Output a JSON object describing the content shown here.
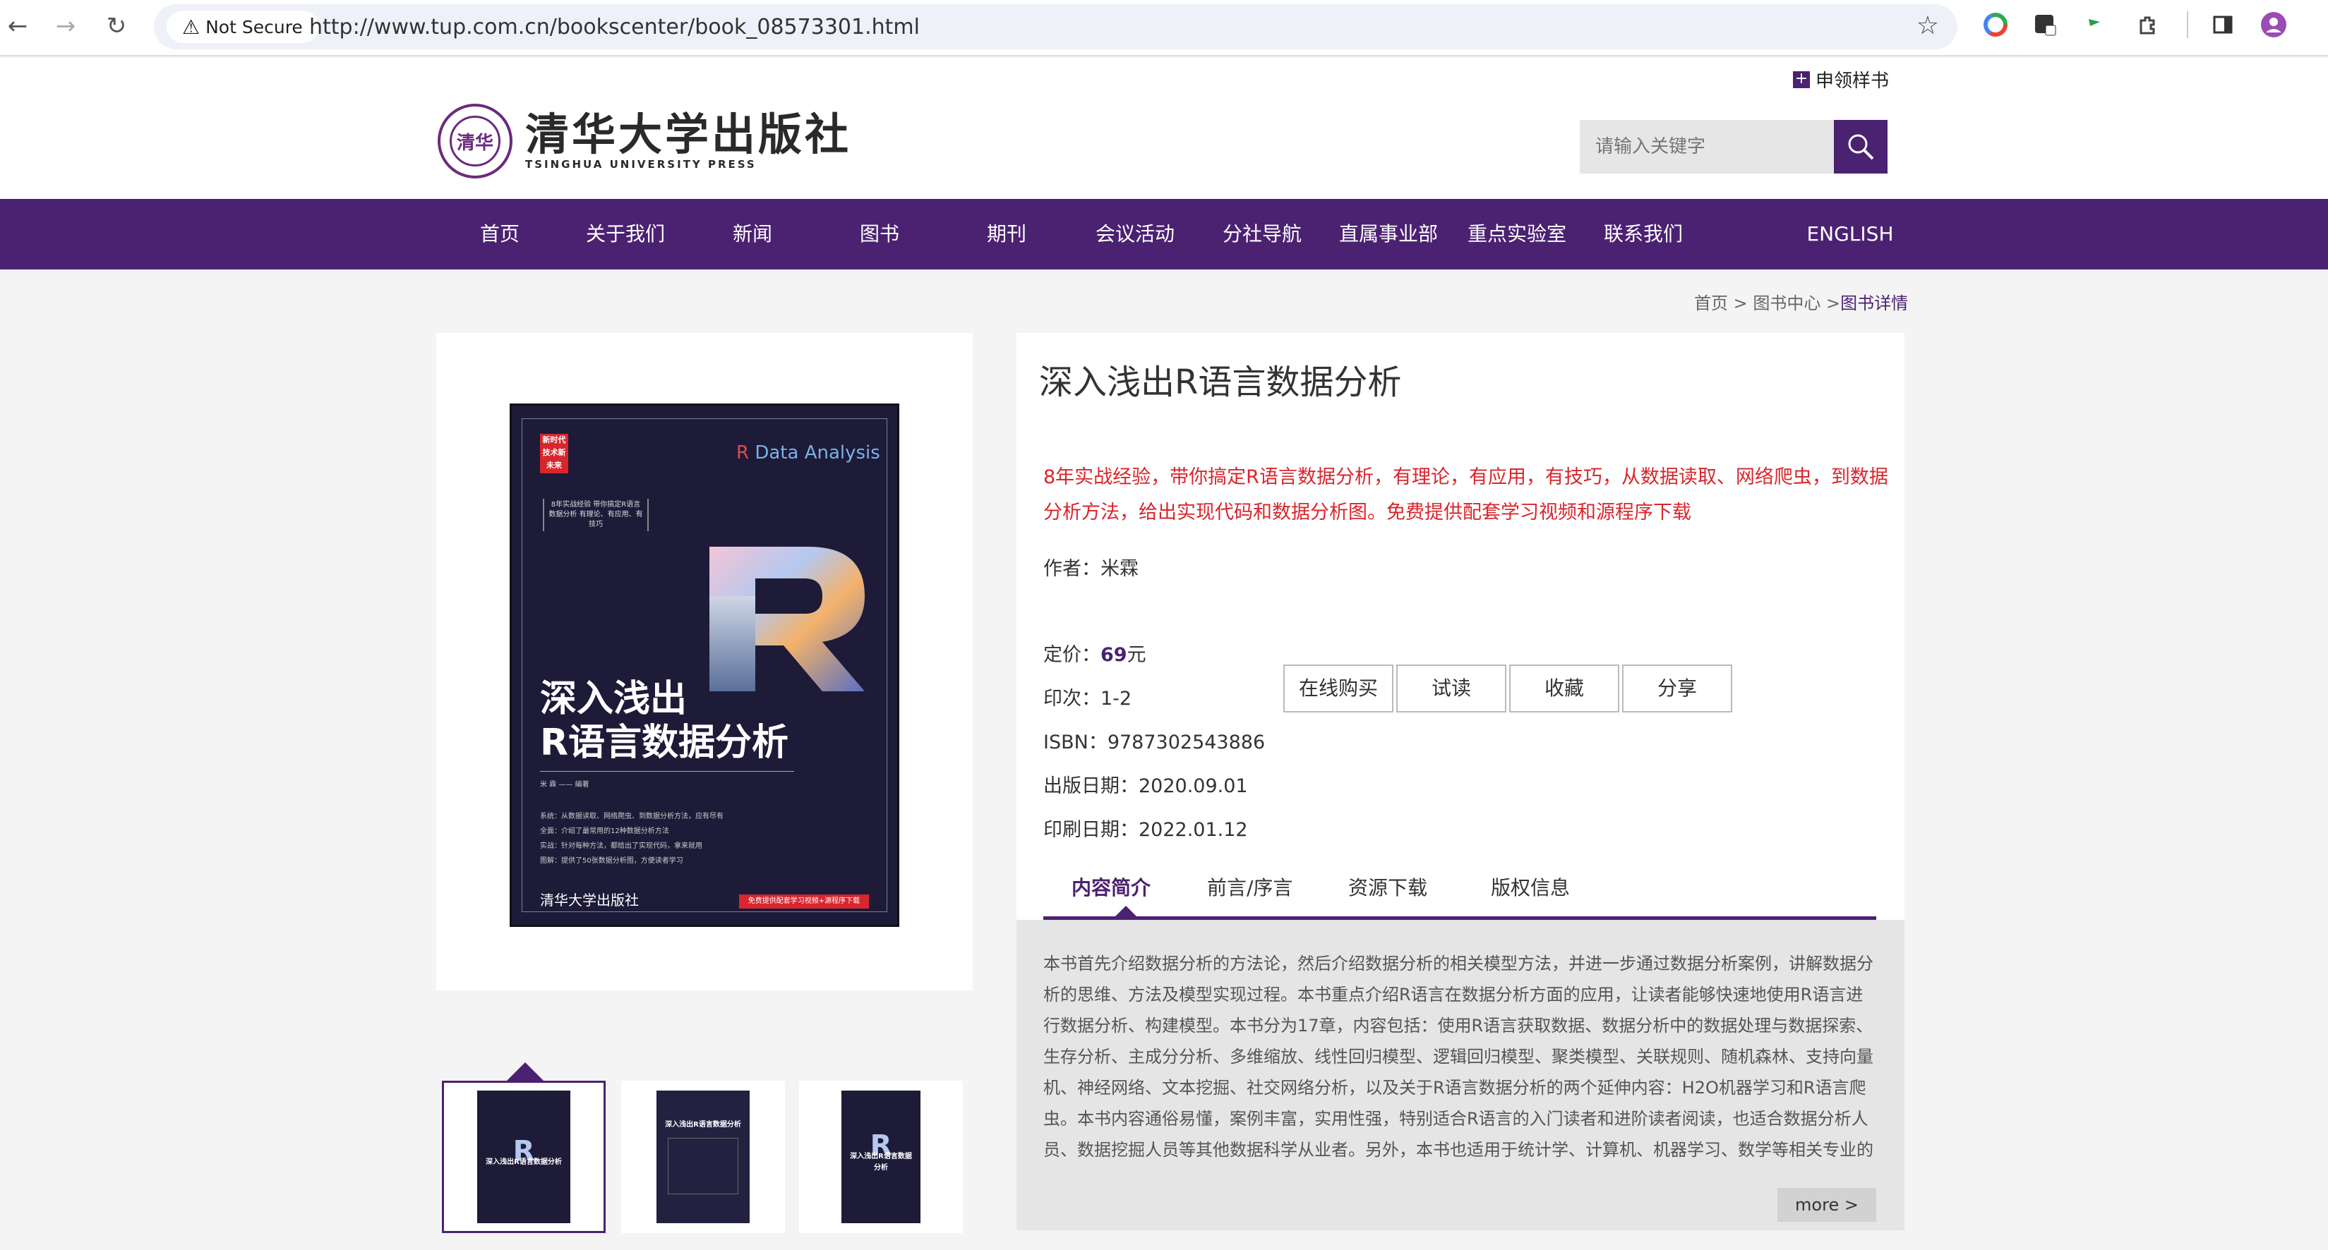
{
  "browser": {
    "security_label": "Not Secure",
    "url": "http://www.tup.com.cn/bookscenter/book_08573301.html"
  },
  "header": {
    "sample_link": "申领样书",
    "logo_cn": "清华大学出版社",
    "logo_en": "TSINGHUA UNIVERSITY PRESS",
    "seal_text": "清华",
    "search_placeholder": "请输入关键字"
  },
  "nav": {
    "items": [
      "首页",
      "关于我们",
      "新闻",
      "图书",
      "期刊",
      "会议活动",
      "分社导航",
      "直属事业部",
      "重点实验室",
      "联系我们",
      "ENGLISH"
    ]
  },
  "breadcrumb": {
    "home": "首页",
    "sep1": " > ",
    "center": "图书中心",
    "sep2": " >",
    "current": "图书详情"
  },
  "cover": {
    "tag": "新时代技术新未来",
    "series_prefix": "R",
    "series": " Data Analysis",
    "blurb": "8年实战经验 带你搞定R语言数据分析 有理论、有应用、有技巧",
    "title_line1": "深入浅出",
    "title_line2": "R语言数据分析",
    "author": "米 霖 —— 编著",
    "bullets": [
      "系统：从数据读取、网络爬虫、到数据分析方法，应有尽有",
      "全面：介绍了最常用的12种数据分析方法",
      "实战：针对每种方法，都给出了实现代码，拿来就用",
      "图解：提供了50张数据分析图，方便读者学习"
    ],
    "publisher": "清华大学出版社",
    "stamp": "免费提供配套学习视频+源程序下载"
  },
  "thumbs": [
    "深入浅出R语言数据分析",
    "深入浅出R语言数据分析",
    "深入浅出R语言数据分析"
  ],
  "book": {
    "title": "深入浅出R语言数据分析",
    "slogan": "8年实战经验，带你搞定R语言数据分析，有理论，有应用，有技巧，从数据读取、网络爬虫，到数据分析方法，给出实现代码和数据分析图。免费提供配套学习视频和源程序下载",
    "author_label": "作者：",
    "author": "米霖",
    "price_label": "定价：",
    "price": "69",
    "price_unit": "元",
    "print_label": "印次：",
    "print": "1-2",
    "isbn_label": "ISBN：",
    "isbn": "9787302543886",
    "pub_date_label": "出版日期：",
    "pub_date": "2020.09.01",
    "print_date_label": "印刷日期：",
    "print_date": "2022.01.12"
  },
  "actions": [
    "在线购买",
    "试读",
    "收藏",
    "分享"
  ],
  "tabs": [
    "内容简介",
    "前言/序言",
    "资源下载",
    "版权信息"
  ],
  "description": "本书首先介绍数据分析的方法论，然后介绍数据分析的相关模型方法，并进一步通过数据分析案例，讲解数据分析的思维、方法及模型实现过程。本书重点介绍R语言在数据分析方面的应用，让读者能够快速地使用R语言进行数据分析、构建模型。本书分为17章，内容包括：使用R语言获取数据、数据分析中的数据处理与数据探索、生存分析、主成分分析、多维缩放、线性回归模型、逻辑回归模型、聚类模型、关联规则、随机森林、支持向量机、神经网络、文本挖掘、社交网络分析，以及关于R语言数据分析的两个延伸内容：H2O机器学习和R语言爬虫。本书内容通俗易懂，案例丰富，实用性强，特别适合R语言的入门读者和进阶读者阅读，也适合数据分析人员、数据挖掘人员等其他数据科学从业者。另外，本书也适用于统计学、计算机、机器学习、数学等相关专业的",
  "more_label": "more >",
  "colors": {
    "brand": "#4b2171",
    "accent_red": "#d8262d"
  }
}
